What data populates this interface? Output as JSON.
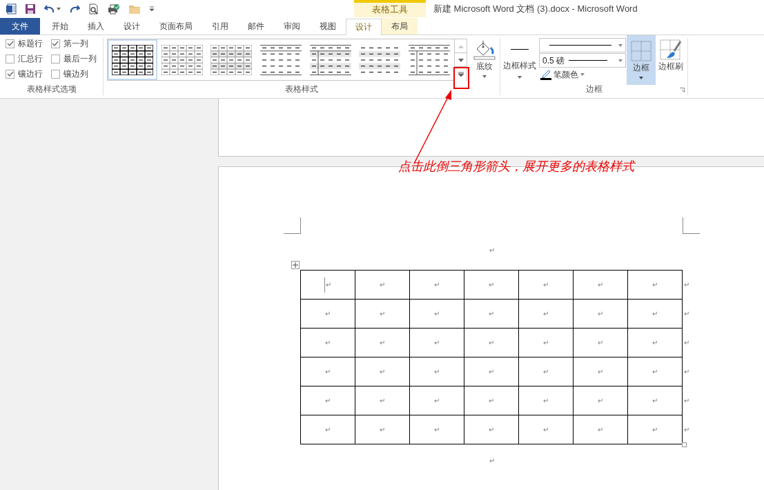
{
  "title_bar": {
    "context_group": "表格工具",
    "title": "新建 Microsoft Word 文档 (3).docx - Microsoft Word"
  },
  "tabs": [
    {
      "label": "文件",
      "kind": "file",
      "selected": false
    },
    {
      "label": "开始",
      "kind": "normal",
      "selected": false
    },
    {
      "label": "插入",
      "kind": "normal",
      "selected": false
    },
    {
      "label": "设计",
      "kind": "normal",
      "selected": false
    },
    {
      "label": "页面布局",
      "kind": "normal",
      "selected": false
    },
    {
      "label": "引用",
      "kind": "normal",
      "selected": false
    },
    {
      "label": "邮件",
      "kind": "normal",
      "selected": false
    },
    {
      "label": "审阅",
      "kind": "normal",
      "selected": false
    },
    {
      "label": "视图",
      "kind": "normal",
      "selected": false
    },
    {
      "label": "设计",
      "kind": "contextual",
      "selected": true
    },
    {
      "label": "布局",
      "kind": "contextual",
      "selected": false
    }
  ],
  "ribbon": {
    "style_options": {
      "label": "表格样式选项",
      "checkboxes": [
        {
          "label": "标题行",
          "checked": true
        },
        {
          "label": "第一列",
          "checked": true
        },
        {
          "label": "汇总行",
          "checked": false
        },
        {
          "label": "最后一列",
          "checked": false
        },
        {
          "label": "镶边行",
          "checked": true
        },
        {
          "label": "镶边列",
          "checked": false
        }
      ]
    },
    "table_styles": {
      "label": "表格样式",
      "gallery": [
        {
          "kind": "grid-bold",
          "selected": true
        },
        {
          "kind": "grid-light",
          "selected": false
        },
        {
          "kind": "grid-banded",
          "selected": false
        },
        {
          "kind": "rules",
          "selected": false
        },
        {
          "kind": "rules-banded-col",
          "selected": false
        },
        {
          "kind": "banded",
          "selected": false
        },
        {
          "kind": "rules-col",
          "selected": false
        }
      ],
      "shading": {
        "label": "底纹"
      }
    },
    "borders": {
      "label": "边框",
      "border_styles": {
        "label": "边框样式"
      },
      "line_weight": {
        "value": "0.5 磅"
      },
      "pen_color": {
        "label": "笔颜色"
      },
      "borders_button": {
        "label": "边框",
        "selected": true
      },
      "border_painter": {
        "label": "边框刷"
      }
    }
  },
  "document": {
    "paragraph_before": "↵",
    "table": {
      "rows": [
        {
          "cells": [
            "↵",
            "↵",
            "↵",
            "↵",
            "↵",
            "↵",
            "↵"
          ],
          "end_mark": "↵"
        },
        {
          "cells": [
            "↵",
            "↵",
            "↵",
            "↵",
            "↵",
            "↵",
            "↵"
          ],
          "end_mark": "↵"
        },
        {
          "cells": [
            "↵",
            "↵",
            "↵",
            "↵",
            "↵",
            "↵",
            "↵"
          ],
          "end_mark": "↵"
        },
        {
          "cells": [
            "↵",
            "↵",
            "↵",
            "↵",
            "↵",
            "↵",
            "↵"
          ],
          "end_mark": "↵"
        },
        {
          "cells": [
            "↵",
            "↵",
            "↵",
            "↵",
            "↵",
            "↵",
            "↵"
          ],
          "end_mark": "↵"
        },
        {
          "cells": [
            "↵",
            "↵",
            "↵",
            "↵",
            "↵",
            "↵",
            "↵"
          ],
          "end_mark": "↵"
        }
      ]
    },
    "paragraph_after": "↵"
  },
  "annotation": {
    "text": "点击此倒三角形箭头，展开更多的表格样式"
  }
}
